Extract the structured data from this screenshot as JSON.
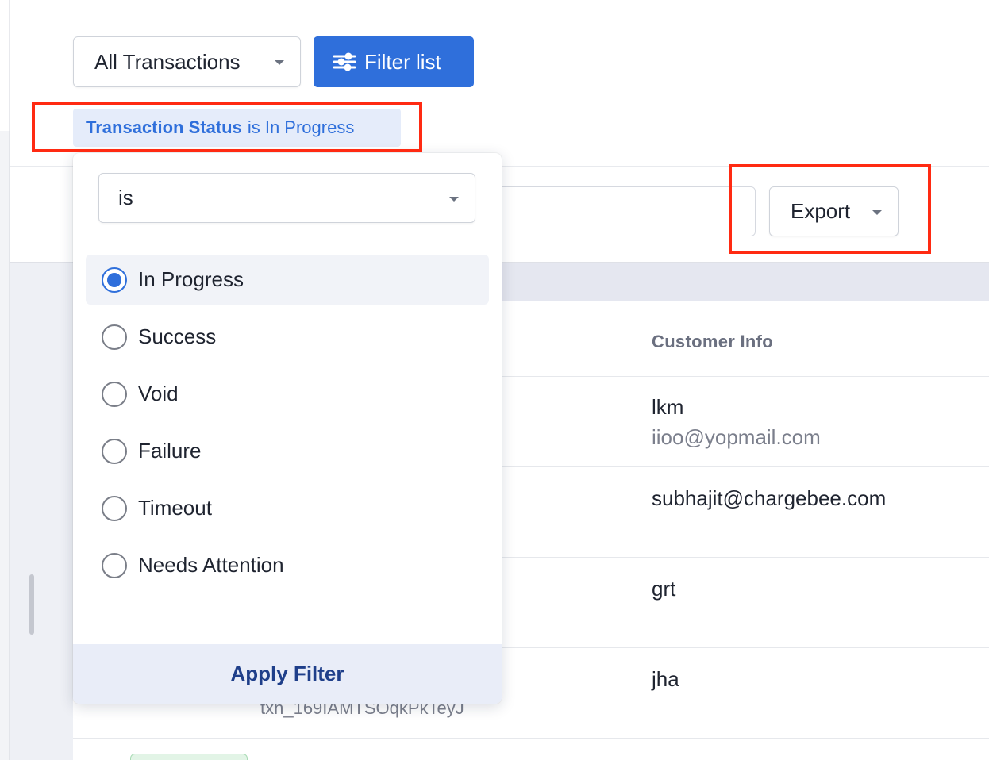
{
  "header": {
    "view_select": "All Transactions",
    "filter_button": "Filter list"
  },
  "active_filter_chip": {
    "field": "Transaction Status",
    "rest": "is In Progress"
  },
  "toolbar": {
    "search_placeholder": "",
    "export_label": "Export"
  },
  "filter_popover": {
    "operator": "is",
    "options": [
      {
        "label": "In Progress",
        "checked": true
      },
      {
        "label": "Success",
        "checked": false
      },
      {
        "label": "Void",
        "checked": false
      },
      {
        "label": "Failure",
        "checked": false
      },
      {
        "label": "Timeout",
        "checked": false
      },
      {
        "label": "Needs Attention",
        "checked": false
      }
    ],
    "apply_label": "Apply Filter"
  },
  "table": {
    "column_header": "Customer Info",
    "rows": [
      {
        "name": "lkm",
        "email": "iioo@yopmail.com"
      },
      {
        "name": "subhajit@chargebee.com",
        "email": ""
      },
      {
        "name": "grt",
        "email": ""
      },
      {
        "name": "jha",
        "email": "",
        "txn_id": "txn_169IAMTSOqkPkTeyJ"
      }
    ]
  },
  "colors": {
    "primary": "#2f6fdb",
    "highlight": "#ff2a12",
    "chip_bg": "#e5ecfa",
    "footer_bg": "#e9edf8"
  }
}
